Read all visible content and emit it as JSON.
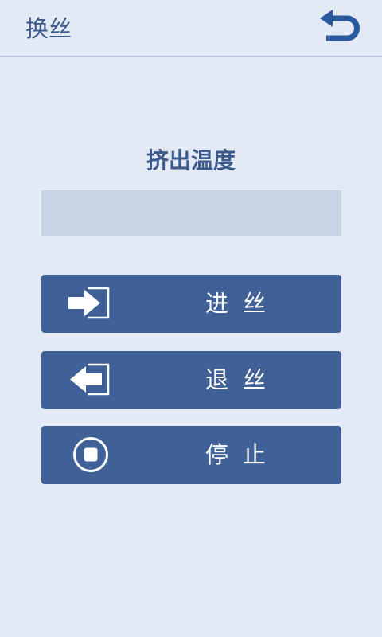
{
  "header": {
    "title": "换丝",
    "back_icon": "undo-arrow-icon"
  },
  "main": {
    "section_label": "挤出温度",
    "temperature_value": ""
  },
  "buttons": {
    "feed": {
      "label": "进丝",
      "icon": "feed-in-icon"
    },
    "retract": {
      "label": "退丝",
      "icon": "retract-out-icon"
    },
    "stop": {
      "label": "停止",
      "icon": "stop-icon"
    }
  },
  "colors": {
    "background": "#e3eaf5",
    "accent": "#3f6198",
    "text": "#3d5a8d",
    "field": "#c8d3e6",
    "back_icon": "#2a5a9c"
  }
}
